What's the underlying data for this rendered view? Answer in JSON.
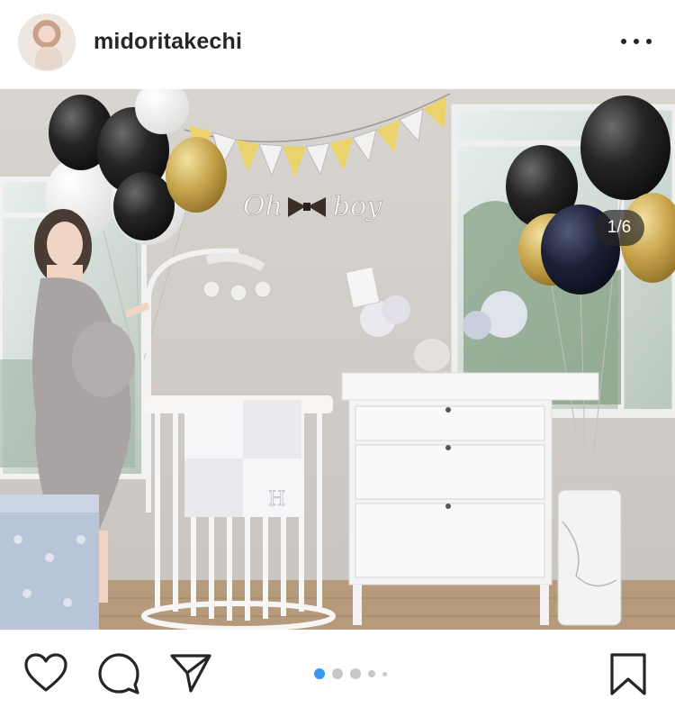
{
  "post": {
    "username": "midoritakechi",
    "carousel_counter": "1/6",
    "image_alt": "Baby nursery with balloons, pennant bunting, a white crib and a white changing dresser",
    "sign_text": "Oh boy",
    "blanket_letter": "H"
  },
  "icons": {
    "avatar": "profile-avatar",
    "more": "more-options-icon",
    "like": "heart-icon",
    "comment": "comment-bubble-icon",
    "share": "paper-plane-icon",
    "save": "bookmark-icon"
  },
  "carousel": {
    "total_dots": 5,
    "active_index": 0,
    "active_color": "#3897f0",
    "inactive_color": "#c7c7c7"
  }
}
